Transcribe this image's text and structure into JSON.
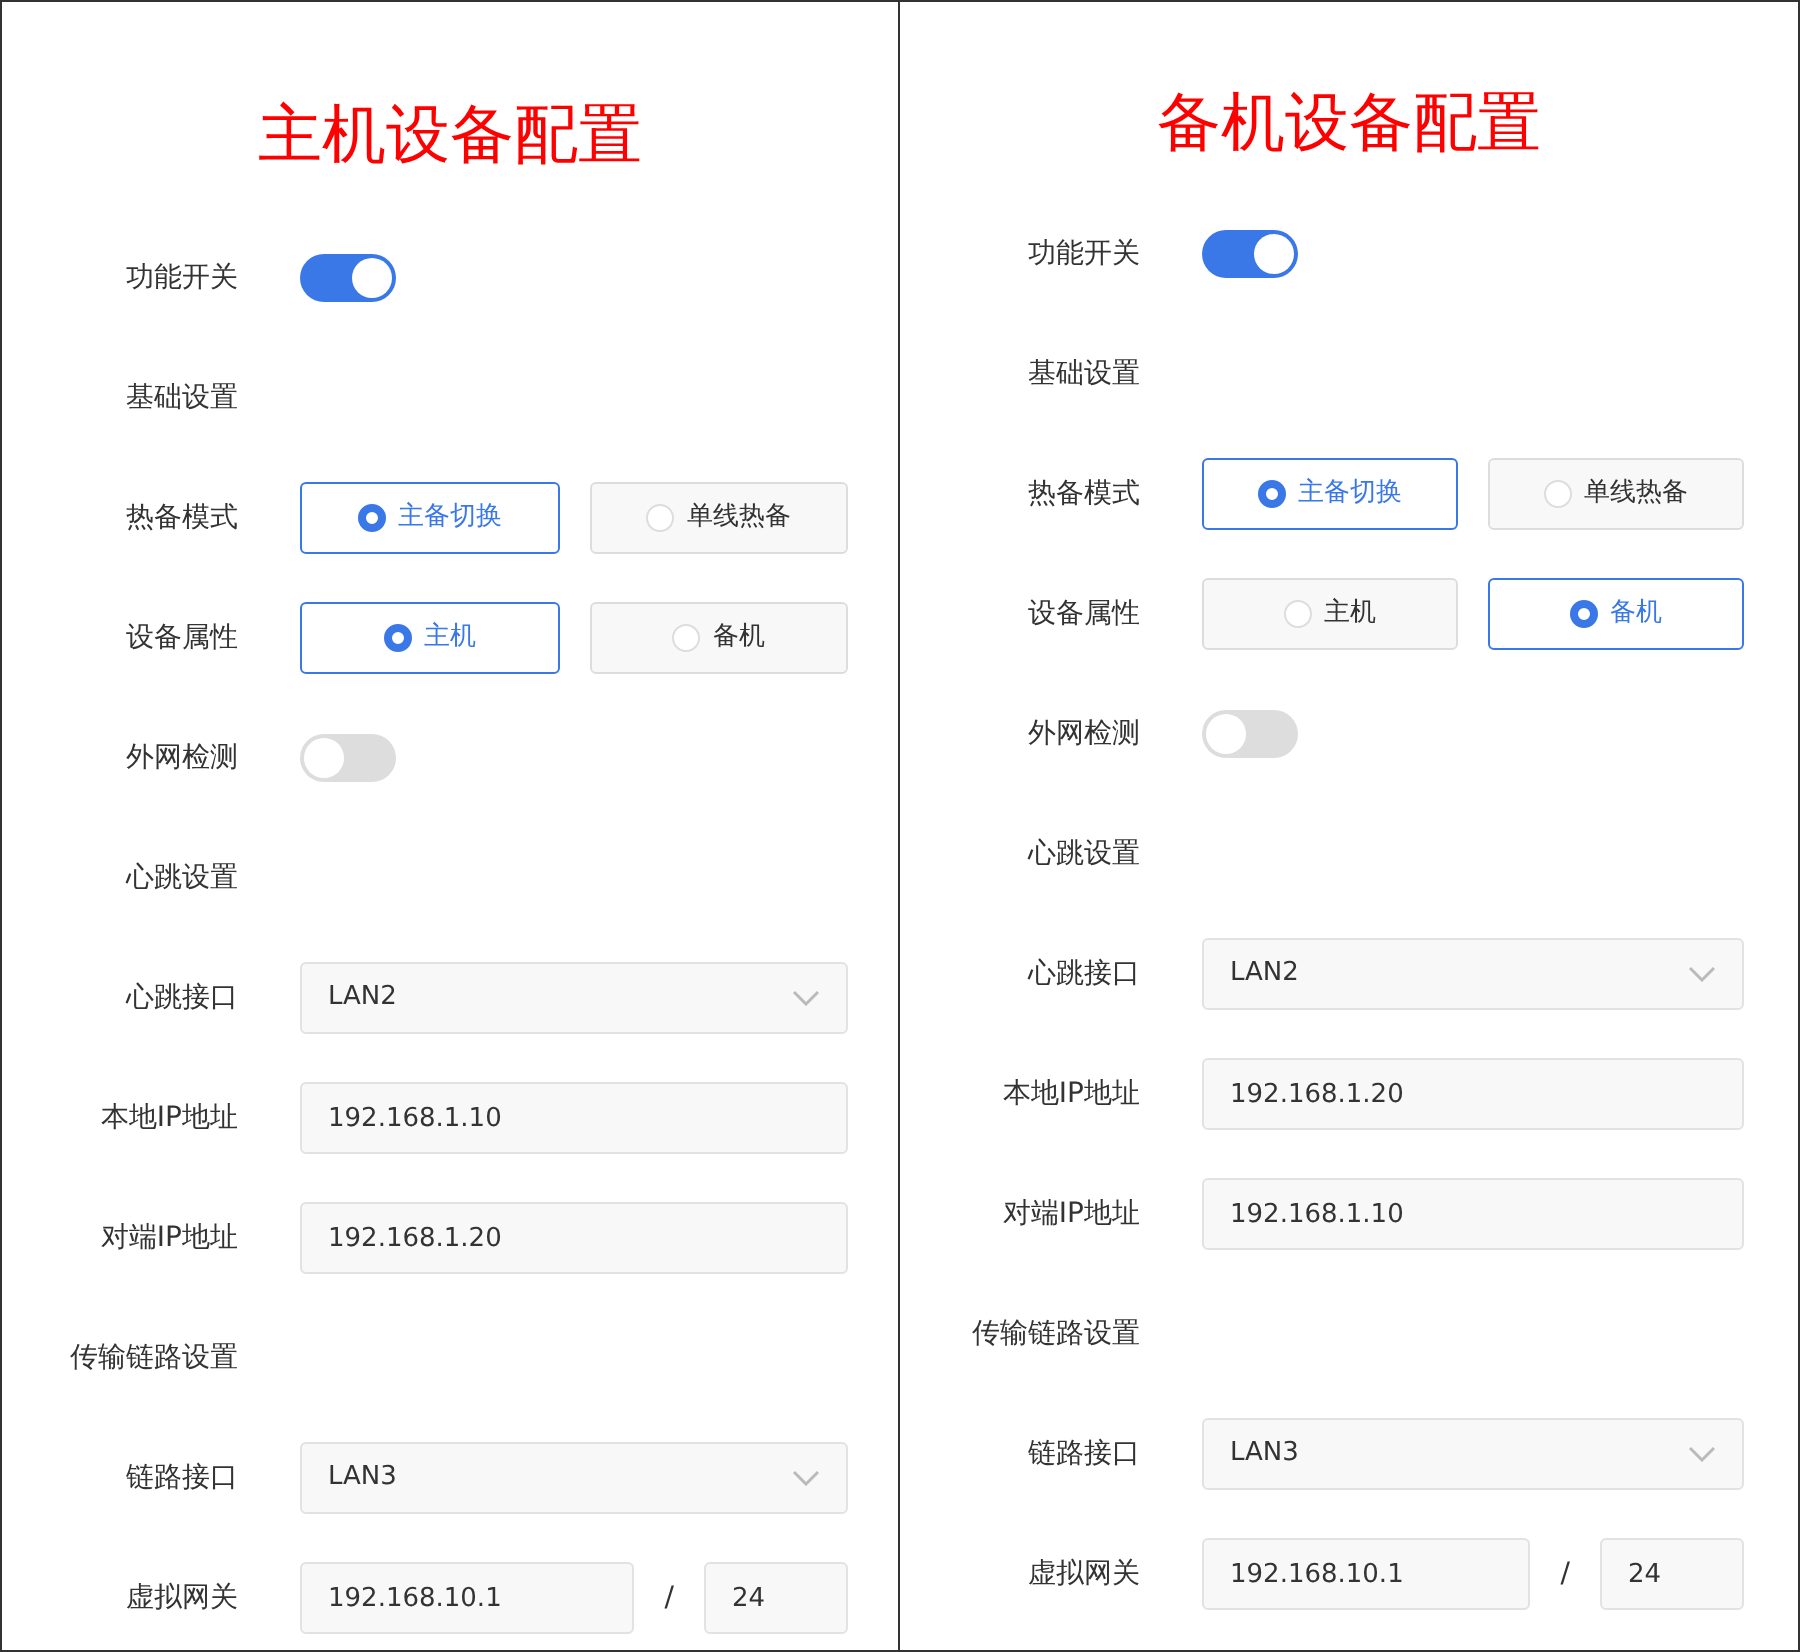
{
  "panels": [
    {
      "title": "主机设备配置",
      "rows": [
        {
          "kind": "switch",
          "label": "功能开关",
          "on": true
        },
        {
          "kind": "section",
          "label": "基础设置"
        },
        {
          "kind": "radio",
          "label": "热备模式",
          "options": [
            {
              "label": "主备切换",
              "selected": true
            },
            {
              "label": "单线热备",
              "selected": false
            }
          ]
        },
        {
          "kind": "radio",
          "label": "设备属性",
          "options": [
            {
              "label": "主机",
              "selected": true
            },
            {
              "label": "备机",
              "selected": false
            }
          ]
        },
        {
          "kind": "switch",
          "label": "外网检测",
          "on": false
        },
        {
          "kind": "section",
          "label": "心跳设置"
        },
        {
          "kind": "select",
          "label": "心跳接口",
          "value": "LAN2"
        },
        {
          "kind": "input",
          "label": "本地IP地址",
          "value": "192.168.1.10"
        },
        {
          "kind": "input",
          "label": "对端IP地址",
          "value": "192.168.1.20"
        },
        {
          "kind": "section",
          "label": "传输链路设置"
        },
        {
          "kind": "select",
          "label": "链路接口",
          "value": "LAN3"
        },
        {
          "kind": "gateway",
          "label": "虚拟网关",
          "value": "192.168.10.1",
          "separator": "/",
          "mask": "24"
        }
      ]
    },
    {
      "title": "备机设备配置",
      "rows": [
        {
          "kind": "switch",
          "label": "功能开关",
          "on": true
        },
        {
          "kind": "section",
          "label": "基础设置"
        },
        {
          "kind": "radio",
          "label": "热备模式",
          "options": [
            {
              "label": "主备切换",
              "selected": true
            },
            {
              "label": "单线热备",
              "selected": false
            }
          ]
        },
        {
          "kind": "radio",
          "label": "设备属性",
          "options": [
            {
              "label": "主机",
              "selected": false
            },
            {
              "label": "备机",
              "selected": true
            }
          ]
        },
        {
          "kind": "switch",
          "label": "外网检测",
          "on": false
        },
        {
          "kind": "section",
          "label": "心跳设置"
        },
        {
          "kind": "select",
          "label": "心跳接口",
          "value": "LAN2"
        },
        {
          "kind": "input",
          "label": "本地IP地址",
          "value": "192.168.1.20"
        },
        {
          "kind": "input",
          "label": "对端IP地址",
          "value": "192.168.1.10"
        },
        {
          "kind": "section",
          "label": "传输链路设置"
        },
        {
          "kind": "select",
          "label": "链路接口",
          "value": "LAN3"
        },
        {
          "kind": "gateway",
          "label": "虚拟网关",
          "value": "192.168.10.1",
          "separator": "/",
          "mask": "24"
        }
      ]
    }
  ]
}
